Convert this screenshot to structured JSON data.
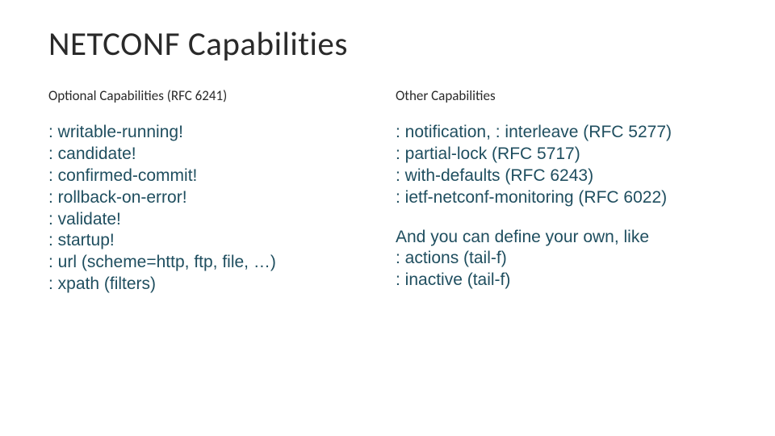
{
  "title": "NETCONF Capabilities",
  "left": {
    "heading": "Optional Capabilities (RFC 6241)",
    "body": ": writable-running!\n: candidate!\n: confirmed-commit!\n: rollback-on-error!\n: validate!\n: startup!\n: url (scheme=http, ftp, file, …)\n: xpath (filters)"
  },
  "right": {
    "heading": "Other Capabilities",
    "body1": ": notification, : interleave (RFC 5277)\n: partial-lock (RFC 5717)\n: with-defaults (RFC 6243)\n: ietf-netconf-monitoring (RFC 6022)",
    "body2": "And you can define your own, like\n: actions (tail-f)\n: inactive (tail-f)"
  }
}
